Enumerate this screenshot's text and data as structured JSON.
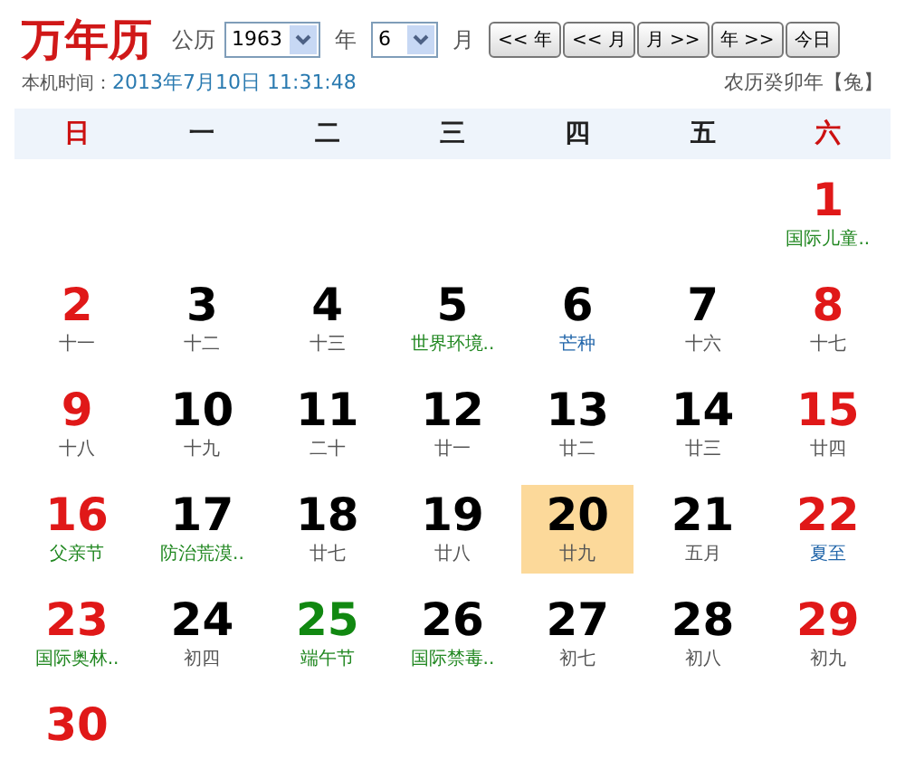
{
  "header": {
    "title": "万年历",
    "calendar_label": "公历",
    "year_select": {
      "value": "1963"
    },
    "year_label": "年",
    "month_select": {
      "value": "6"
    },
    "month_label": "月",
    "nav_buttons": [
      "<< 年",
      "<< 月",
      "月 >>",
      "年 >>",
      "今日"
    ],
    "clock_label": "本机时间：",
    "clock_value": "2013年7月10日 11:31:48",
    "lunar_year": "农历癸卯年【兔】"
  },
  "weekdays": [
    {
      "label": "日",
      "kind": "weekend"
    },
    {
      "label": "一",
      "kind": "weekday"
    },
    {
      "label": "二",
      "kind": "weekday"
    },
    {
      "label": "三",
      "kind": "weekday"
    },
    {
      "label": "四",
      "kind": "weekday"
    },
    {
      "label": "五",
      "kind": "weekday"
    },
    {
      "label": "六",
      "kind": "weekend"
    }
  ],
  "weeks": [
    [
      {
        "kind": "empty"
      },
      {
        "kind": "empty"
      },
      {
        "kind": "empty"
      },
      {
        "kind": "empty"
      },
      {
        "kind": "empty"
      },
      {
        "kind": "empty"
      },
      {
        "kind": "weekend",
        "day": "1",
        "note": {
          "kind": "festival",
          "text": "国际儿童.."
        },
        "selected": false
      }
    ],
    [
      {
        "kind": "weekend",
        "day": "2",
        "note": {
          "kind": "lunar",
          "text": "十一"
        },
        "selected": false
      },
      {
        "kind": "normal",
        "day": "3",
        "note": {
          "kind": "lunar",
          "text": "十二"
        },
        "selected": false
      },
      {
        "kind": "normal",
        "day": "4",
        "note": {
          "kind": "lunar",
          "text": "十三"
        },
        "selected": false
      },
      {
        "kind": "normal",
        "day": "5",
        "note": {
          "kind": "festival",
          "text": "世界环境.."
        },
        "selected": false
      },
      {
        "kind": "normal",
        "day": "6",
        "note": {
          "kind": "term",
          "text": "芒种"
        },
        "selected": false
      },
      {
        "kind": "normal",
        "day": "7",
        "note": {
          "kind": "lunar",
          "text": "十六"
        },
        "selected": false
      },
      {
        "kind": "weekend",
        "day": "8",
        "note": {
          "kind": "lunar",
          "text": "十七"
        },
        "selected": false
      }
    ],
    [
      {
        "kind": "weekend",
        "day": "9",
        "note": {
          "kind": "lunar",
          "text": "十八"
        },
        "selected": false
      },
      {
        "kind": "normal",
        "day": "10",
        "note": {
          "kind": "lunar",
          "text": "十九"
        },
        "selected": false
      },
      {
        "kind": "normal",
        "day": "11",
        "note": {
          "kind": "lunar",
          "text": "二十"
        },
        "selected": false
      },
      {
        "kind": "normal",
        "day": "12",
        "note": {
          "kind": "lunar",
          "text": "廿一"
        },
        "selected": false
      },
      {
        "kind": "normal",
        "day": "13",
        "note": {
          "kind": "lunar",
          "text": "廿二"
        },
        "selected": false
      },
      {
        "kind": "normal",
        "day": "14",
        "note": {
          "kind": "lunar",
          "text": "廿三"
        },
        "selected": false
      },
      {
        "kind": "weekend",
        "day": "15",
        "note": {
          "kind": "lunar",
          "text": "廿四"
        },
        "selected": false
      }
    ],
    [
      {
        "kind": "weekend",
        "day": "16",
        "note": {
          "kind": "festival",
          "text": "父亲节"
        },
        "selected": false
      },
      {
        "kind": "normal",
        "day": "17",
        "note": {
          "kind": "festival",
          "text": "防治荒漠.."
        },
        "selected": false
      },
      {
        "kind": "normal",
        "day": "18",
        "note": {
          "kind": "lunar",
          "text": "廿七"
        },
        "selected": false
      },
      {
        "kind": "normal",
        "day": "19",
        "note": {
          "kind": "lunar",
          "text": "廿八"
        },
        "selected": false
      },
      {
        "kind": "normal",
        "day": "20",
        "note": {
          "kind": "lunar",
          "text": "廿九"
        },
        "selected": true
      },
      {
        "kind": "normal",
        "day": "21",
        "note": {
          "kind": "lunar",
          "text": "五月"
        },
        "selected": false
      },
      {
        "kind": "weekend",
        "day": "22",
        "note": {
          "kind": "term",
          "text": "夏至"
        },
        "selected": false
      }
    ],
    [
      {
        "kind": "weekend",
        "day": "23",
        "note": {
          "kind": "festival",
          "text": "国际奥林.."
        },
        "selected": false
      },
      {
        "kind": "normal",
        "day": "24",
        "note": {
          "kind": "lunar",
          "text": "初四"
        },
        "selected": false
      },
      {
        "kind": "holiday",
        "day": "25",
        "note": {
          "kind": "festival",
          "text": "端午节"
        },
        "selected": false
      },
      {
        "kind": "normal",
        "day": "26",
        "note": {
          "kind": "festival",
          "text": "国际禁毒.."
        },
        "selected": false
      },
      {
        "kind": "normal",
        "day": "27",
        "note": {
          "kind": "lunar",
          "text": "初七"
        },
        "selected": false
      },
      {
        "kind": "normal",
        "day": "28",
        "note": {
          "kind": "lunar",
          "text": "初八"
        },
        "selected": false
      },
      {
        "kind": "weekend",
        "day": "29",
        "note": {
          "kind": "lunar",
          "text": "初九"
        },
        "selected": false
      }
    ],
    [
      {
        "kind": "weekend",
        "day": "30",
        "selected": false
      },
      {
        "kind": "empty"
      },
      {
        "kind": "empty"
      },
      {
        "kind": "empty"
      },
      {
        "kind": "empty"
      },
      {
        "kind": "empty"
      },
      {
        "kind": "empty"
      }
    ]
  ]
}
